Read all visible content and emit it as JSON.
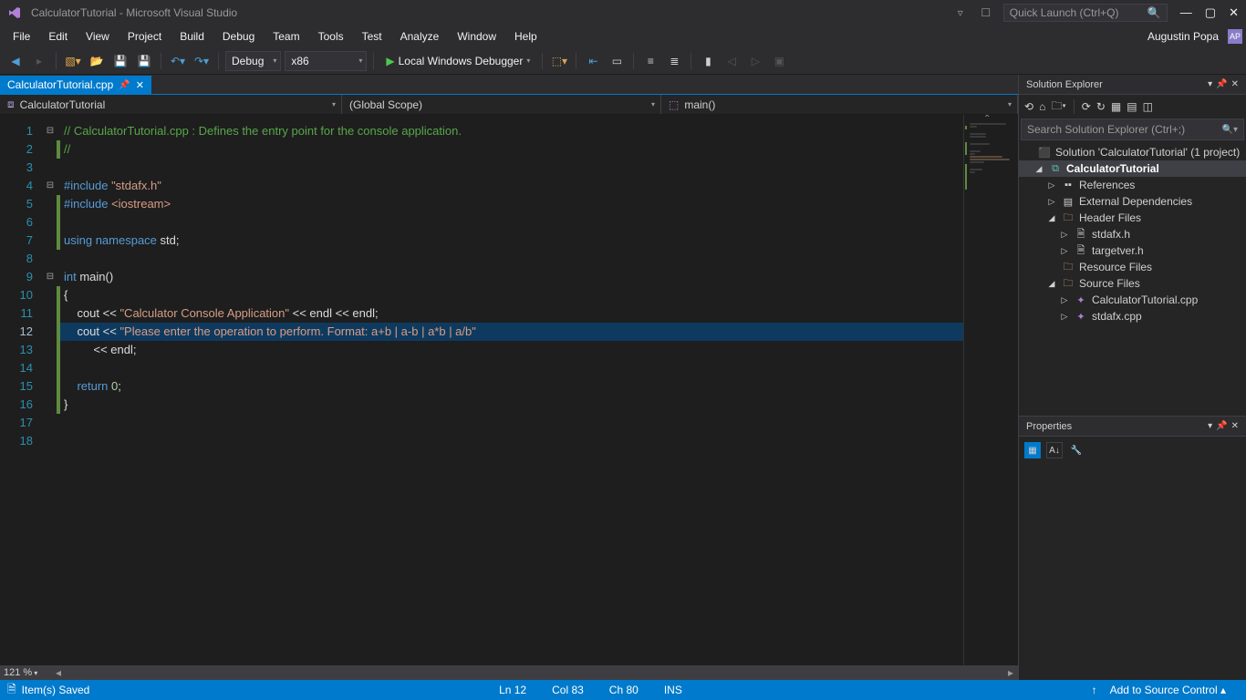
{
  "title": "CalculatorTutorial - Microsoft Visual Studio",
  "quick_launch_placeholder": "Quick Launch (Ctrl+Q)",
  "menu": [
    "File",
    "Edit",
    "View",
    "Project",
    "Build",
    "Debug",
    "Team",
    "Tools",
    "Test",
    "Analyze",
    "Window",
    "Help"
  ],
  "user": "Augustin Popa",
  "toolbar": {
    "config": "Debug",
    "platform": "x86",
    "start": "Local Windows Debugger"
  },
  "tab": {
    "name": "CalculatorTutorial.cpp"
  },
  "nav": {
    "scope1": "CalculatorTutorial",
    "scope2": "(Global Scope)",
    "scope3": "main()"
  },
  "zoom": "121 %",
  "code_lines": [
    {
      "n": 1,
      "fold": "⊟",
      "change": "",
      "html": "<span class='c-comment'>// CalculatorTutorial.cpp : Defines the entry point for the console application.</span>"
    },
    {
      "n": 2,
      "fold": "",
      "change": "cb-green",
      "html": "<span class='c-comment'>//</span>"
    },
    {
      "n": 3,
      "fold": "",
      "change": "",
      "html": ""
    },
    {
      "n": 4,
      "fold": "⊟",
      "change": "",
      "html": "<span class='c-keyword'>#include</span> <span class='c-string'>\"stdafx.h\"</span>"
    },
    {
      "n": 5,
      "fold": "",
      "change": "cb-green",
      "html": "<span class='c-keyword'>#include</span> <span class='c-string'>&lt;iostream&gt;</span>"
    },
    {
      "n": 6,
      "fold": "",
      "change": "cb-green",
      "html": ""
    },
    {
      "n": 7,
      "fold": "",
      "change": "cb-green",
      "html": "<span class='c-keyword'>using</span> <span class='c-keyword'>namespace</span> std;"
    },
    {
      "n": 8,
      "fold": "",
      "change": "",
      "html": ""
    },
    {
      "n": 9,
      "fold": "⊟",
      "change": "",
      "html": "<span class='c-type'>int</span> main()"
    },
    {
      "n": 10,
      "fold": "",
      "change": "cb-green",
      "html": "{"
    },
    {
      "n": 11,
      "fold": "",
      "change": "cb-green",
      "html": "    cout &lt;&lt; <span class='c-string'>\"Calculator Console Application\"</span> &lt;&lt; endl &lt;&lt; endl;"
    },
    {
      "n": 12,
      "fold": "",
      "change": "cb-green",
      "hl": true,
      "html": "    cout &lt;&lt; <span class='c-string'>\"Please enter the operation to perform. Format: a+b | a-b | a*b | a/b\"</span>"
    },
    {
      "n": 13,
      "fold": "",
      "change": "cb-green",
      "html": "         &lt;&lt; endl;"
    },
    {
      "n": 14,
      "fold": "",
      "change": "cb-green",
      "html": ""
    },
    {
      "n": 15,
      "fold": "",
      "change": "cb-green",
      "html": "    <span class='c-keyword'>return</span> <span class='c-num'>0</span>;"
    },
    {
      "n": 16,
      "fold": "",
      "change": "cb-green",
      "html": "}"
    },
    {
      "n": 17,
      "fold": "",
      "change": "",
      "html": ""
    },
    {
      "n": 18,
      "fold": "",
      "change": "",
      "html": ""
    }
  ],
  "current_line": 12,
  "solution_explorer": {
    "title": "Solution Explorer",
    "search_placeholder": "Search Solution Explorer (Ctrl+;)",
    "root": "Solution 'CalculatorTutorial' (1 project)",
    "project": "CalculatorTutorial",
    "nodes": {
      "references": "References",
      "external": "External Dependencies",
      "header_files": "Header Files",
      "stdafx_h": "stdafx.h",
      "targetver_h": "targetver.h",
      "resource_files": "Resource Files",
      "source_files": "Source Files",
      "calc_cpp": "CalculatorTutorial.cpp",
      "stdafx_cpp": "stdafx.cpp"
    }
  },
  "properties": {
    "title": "Properties"
  },
  "status": {
    "saved": "Item(s) Saved",
    "ln": "Ln 12",
    "col": "Col 83",
    "ch": "Ch 80",
    "ins": "INS",
    "source_control": "Add to Source Control"
  }
}
